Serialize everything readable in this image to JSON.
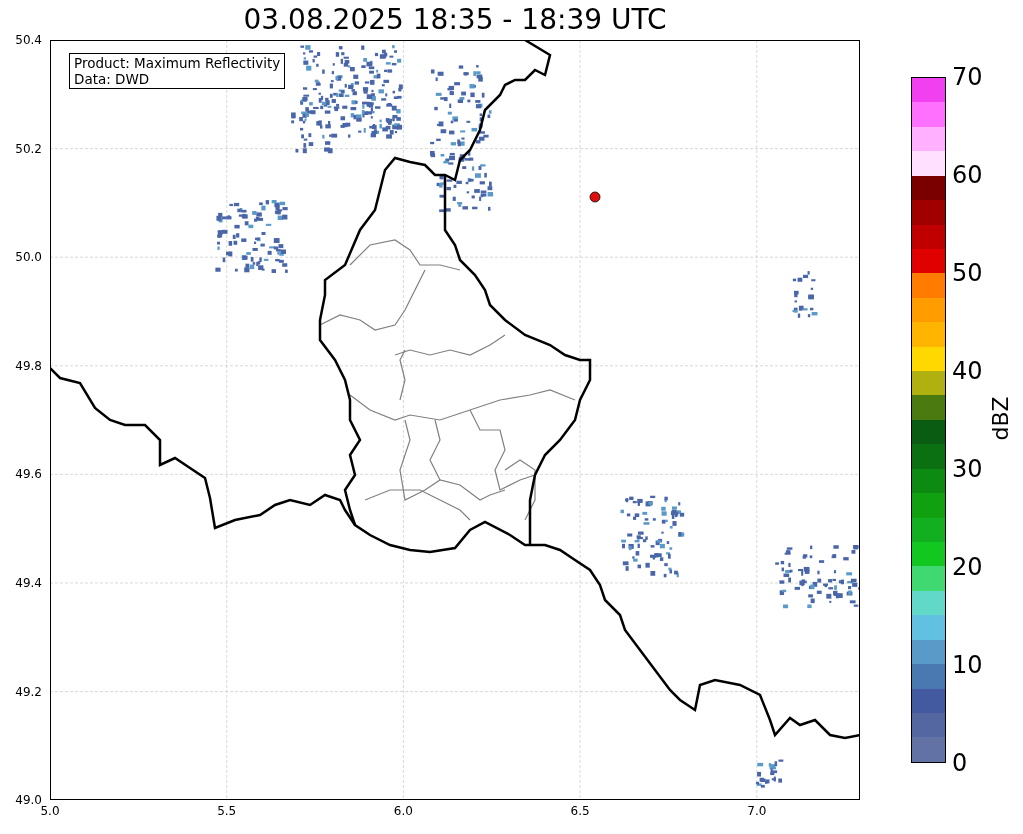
{
  "title": "03.08.2025 18:35 - 18:39 UTC",
  "map": {
    "info_box": [
      "Product: Maximum Reflectivity",
      "Data: DWD"
    ],
    "x_ticks": [
      "5.0",
      "5.5",
      "6.0",
      "6.5",
      "7.0"
    ],
    "y_ticks": [
      "50.4",
      "50.2",
      "50.0",
      "49.8",
      "49.6",
      "49.4",
      "49.2",
      "49.0"
    ]
  },
  "colorbar": {
    "label": "dBZ",
    "ticks": [
      "70",
      "60",
      "50",
      "40",
      "30",
      "20",
      "10",
      "0"
    ],
    "bands": [
      {
        "color": "#6272a4"
      },
      {
        "color": "#5567a0"
      },
      {
        "color": "#445aa0"
      },
      {
        "color": "#4a78b0"
      },
      {
        "color": "#5a9ac8"
      },
      {
        "color": "#62c0e0"
      },
      {
        "color": "#62d8c8"
      },
      {
        "color": "#40d870"
      },
      {
        "color": "#12c820"
      },
      {
        "color": "#12b020"
      },
      {
        "color": "#10a010"
      },
      {
        "color": "#0c8a12"
      },
      {
        "color": "#0a7012"
      },
      {
        "color": "#0a5c12"
      },
      {
        "color": "#4a7a10"
      },
      {
        "color": "#b0b010"
      },
      {
        "color": "#ffd800"
      },
      {
        "color": "#ffb400"
      },
      {
        "color": "#ff9c00"
      },
      {
        "color": "#ff7c00"
      },
      {
        "color": "#e00000"
      },
      {
        "color": "#c00000"
      },
      {
        "color": "#a00000"
      },
      {
        "color": "#7a0000"
      },
      {
        "color": "#ffe0ff"
      },
      {
        "color": "#ffb0ff"
      },
      {
        "color": "#ff70ff"
      },
      {
        "color": "#f040f0"
      }
    ]
  }
}
